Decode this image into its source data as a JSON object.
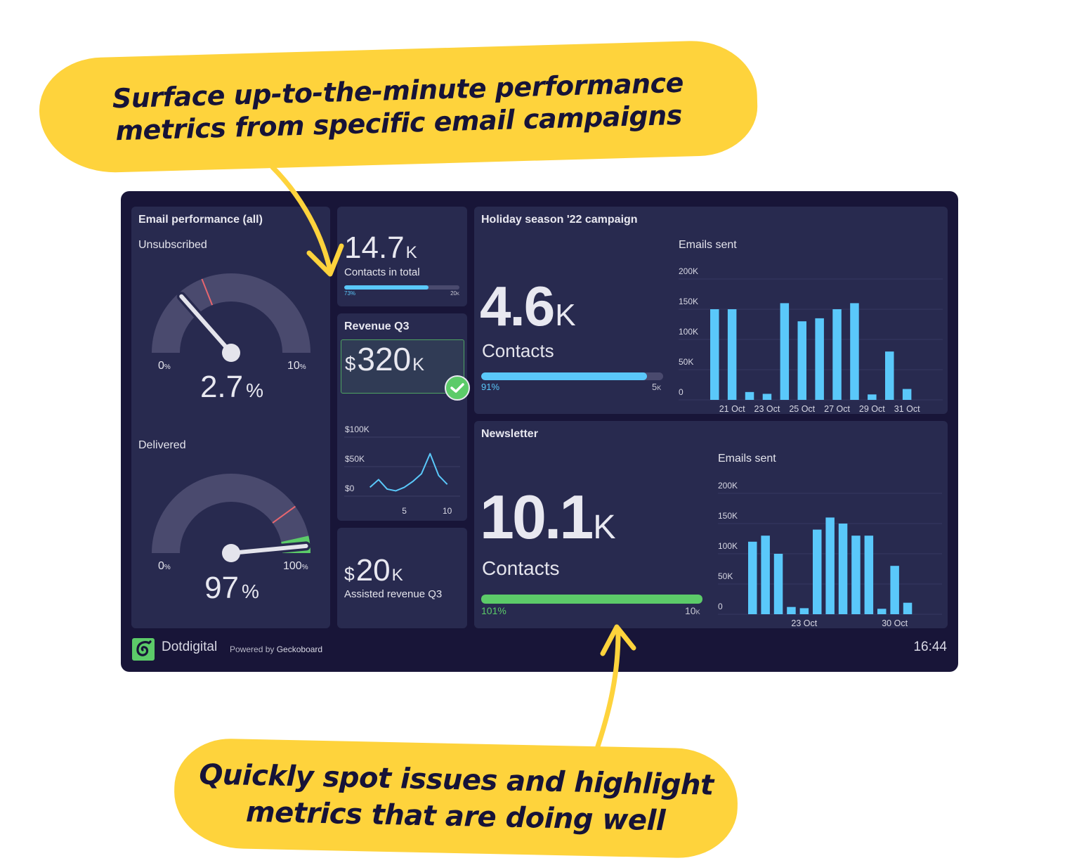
{
  "callouts": {
    "top": [
      "Surface up-to-the-minute performance",
      "metrics from specific email campaigns"
    ],
    "bottom": [
      "Quickly spot issues and highlight",
      "metrics that are doing well"
    ],
    "color": "#fed33c",
    "text_color": "#161338"
  },
  "colors": {
    "dashboard_bg": "#181538",
    "card_bg": "#282a4f",
    "accent_blue": "#5ac8fa",
    "success_green": "#5ccb69",
    "threshold_red": "#e8666f",
    "gauge_track": "#4a4a6e"
  },
  "email_performance": {
    "title": "Email performance (all)",
    "unsubscribed": {
      "label": "Unsubscribed",
      "value": 2.7,
      "value_text": "2.7",
      "unit": "%",
      "min_text": "0",
      "max_text": "10",
      "axis_unit": "%",
      "min": 0,
      "max": 10,
      "threshold_red": 3.8
    },
    "delivered": {
      "label": "Delivered",
      "value": 97,
      "value_text": "97",
      "unit": "%",
      "min_text": "0",
      "max_text": "100",
      "axis_unit": "%",
      "min": 0,
      "max": 100,
      "threshold_red": 80,
      "green_from": 93
    }
  },
  "contacts_total": {
    "value": "14.7",
    "suffix": "K",
    "label": "Contacts in total",
    "progress": 0.73,
    "progress_text": "73%",
    "goal_text": "20",
    "goal_suffix": "K"
  },
  "revenue_q3": {
    "title": "Revenue Q3",
    "prefix": "$",
    "value": "320",
    "suffix": "K",
    "status": "goal-met"
  },
  "assisted_revenue": {
    "prefix": "$",
    "value": "20",
    "suffix": "K",
    "label": "Assisted revenue Q3"
  },
  "holiday": {
    "title": "Holiday season '22 campaign",
    "value": "4.6",
    "suffix": "K",
    "label": "Contacts",
    "progress": 0.91,
    "progress_text": "91%",
    "goal_text": "5",
    "goal_suffix": "K"
  },
  "newsletter": {
    "title": "Newsletter",
    "value": "10.1",
    "suffix": "K",
    "label": "Contacts",
    "progress": 1.0,
    "progress_text": "101%",
    "goal_text": "10",
    "goal_suffix": "K"
  },
  "footer": {
    "brand": "Dotdigital",
    "powered_prefix": "Powered by",
    "powered_name": "Geckoboard",
    "time": "16:44"
  },
  "chart_data": [
    {
      "id": "revenue_line",
      "type": "line",
      "title": "",
      "x": [
        1,
        2,
        3,
        4,
        5,
        6,
        7,
        8,
        9,
        10
      ],
      "values": [
        15000,
        28000,
        12000,
        9000,
        15000,
        25000,
        38000,
        72000,
        35000,
        20000
      ],
      "xticks": [
        5,
        10
      ],
      "xtick_labels": [
        "5",
        "10"
      ],
      "yticks": [
        0,
        50000,
        100000
      ],
      "ytick_labels": [
        "$0",
        "$50K",
        "$100K"
      ],
      "xlim": [
        -2,
        11.5
      ],
      "ylim": [
        0,
        100000
      ],
      "grid": true,
      "color": "#5ac8fa"
    },
    {
      "id": "holiday_bars",
      "type": "bar",
      "title": "Emails sent",
      "categories": [
        "20 Oct",
        "21 Oct",
        "22 Oct",
        "23 Oct",
        "24 Oct",
        "25 Oct",
        "26 Oct",
        "27 Oct",
        "28 Oct",
        "29 Oct",
        "30 Oct",
        "31 Oct"
      ],
      "values": [
        150000,
        150000,
        13000,
        10000,
        160000,
        130000,
        135000,
        150000,
        160000,
        9000,
        80000,
        18000
      ],
      "xtick_labels": [
        "21 Oct",
        "23 Oct",
        "25 Oct",
        "27 Oct",
        "29 Oct",
        "31 Oct"
      ],
      "xtick_indices": [
        1,
        3,
        5,
        7,
        9,
        11
      ],
      "yticks": [
        0,
        50000,
        100000,
        150000,
        200000
      ],
      "ytick_labels": [
        "0",
        "50K",
        "100K",
        "150K",
        "200K"
      ],
      "ylim": [
        0,
        200000
      ],
      "grid": true,
      "color": "#5ac8fa"
    },
    {
      "id": "newsletter_bars",
      "type": "bar",
      "title": "Emails sent",
      "categories": [
        "19 Oct",
        "20 Oct",
        "21 Oct",
        "22 Oct",
        "23 Oct",
        "24 Oct",
        "25 Oct",
        "26 Oct",
        "27 Oct",
        "28 Oct",
        "29 Oct",
        "30 Oct",
        "31 Oct"
      ],
      "values": [
        120000,
        130000,
        100000,
        12000,
        10000,
        140000,
        160000,
        150000,
        130000,
        130000,
        9000,
        80000,
        19000
      ],
      "xtick_labels": [
        "23 Oct",
        "30 Oct"
      ],
      "xtick_indices": [
        4,
        11
      ],
      "yticks": [
        0,
        50000,
        100000,
        150000,
        200000
      ],
      "ytick_labels": [
        "0",
        "50K",
        "100K",
        "150K",
        "200K"
      ],
      "ylim": [
        0,
        200000
      ],
      "grid": true,
      "color": "#5ac8fa"
    }
  ]
}
